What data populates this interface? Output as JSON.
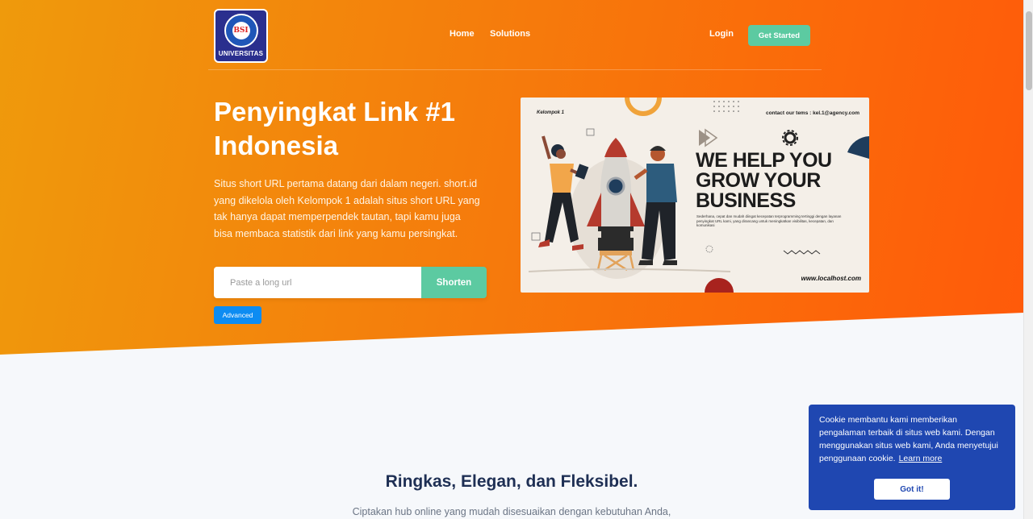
{
  "nav": {
    "logo_text": "UNIVERSITAS",
    "logo_mark": "BSI",
    "home": "Home",
    "solutions": "Solutions",
    "login": "Login",
    "get_started": "Get Started"
  },
  "hero": {
    "title": "Penyingkat Link #1 Indonesia",
    "description": "Situs short URL pertama datang dari dalam negeri. short.id yang dikelola oleh Kelompok 1 adalah situs short URL yang tak hanya dapat memperpendek tautan, tapi kamu juga bisa membaca statistik dari link yang kamu persingkat.",
    "url_placeholder": "Paste a long url",
    "url_value": "",
    "shorten_label": "Shorten",
    "advanced_label": "Advanced"
  },
  "banner": {
    "group": "Kelompok 1",
    "contact": "contact our tems : kel.1@agency.com",
    "headline": "WE HELP YOU GROW YOUR BUSINESS",
    "small_text": "Sederhana, cepat dan mudah diingat kecepatan terprogramming tertinggi dengan layanan penyingkat URL kami, yang dirancang untuk meningkatkan visibilitas, kecepatan, dan komunikasi",
    "url": "www.localhost.com"
  },
  "section": {
    "title": "Ringkas, Elegan, dan Fleksibel.",
    "subtitle": "Ciptakan hub online yang mudah disesuaikan dengan kebutuhan Anda,"
  },
  "cookie": {
    "message": "Cookie membantu kami memberikan pengalaman terbaik di situs web kami. Dengan menggunakan situs web kami, Anda menyetujui penggunaan cookie.",
    "learn_more": "Learn more",
    "button": "Got it!"
  },
  "colors": {
    "accent": "#5ccaa1",
    "hero_start": "#ef9a0c",
    "hero_end": "#ff5a0a",
    "cookie_bg": "#1f47b1",
    "advanced_btn": "#0d8cf2"
  }
}
